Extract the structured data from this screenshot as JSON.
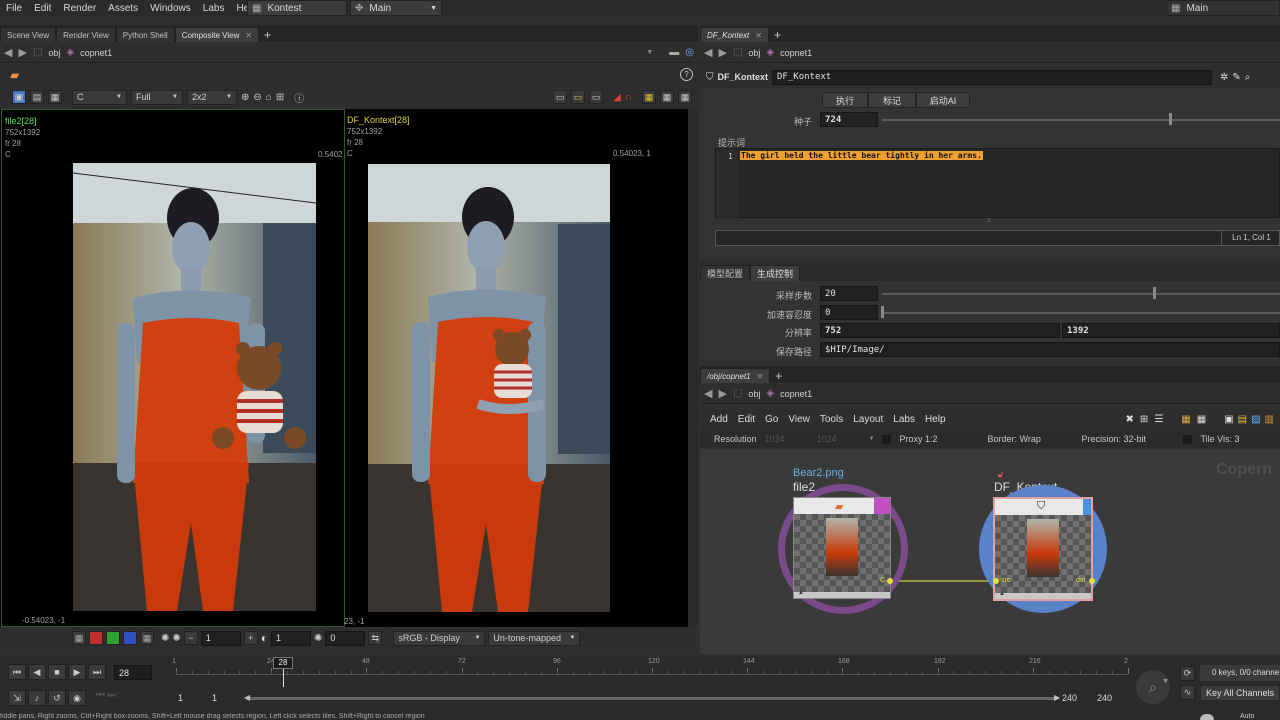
{
  "menubar": {
    "items": [
      "File",
      "Edit",
      "Render",
      "Assets",
      "Windows",
      "Labs",
      "Help"
    ],
    "desktop": "Kontest",
    "network": "Main",
    "right_desktop": "Main"
  },
  "left_tabs": [
    {
      "label": "Scene View",
      "active": false
    },
    {
      "label": "Render View",
      "active": false
    },
    {
      "label": "Python Shell",
      "active": false
    },
    {
      "label": "Composite View",
      "active": true
    }
  ],
  "left_path": {
    "seg1": "obj",
    "seg2": "copnet1"
  },
  "viewer_toolbar": {
    "plane": "C",
    "res": "Full",
    "layout": "2x2"
  },
  "viewport_left": {
    "title": "file2[28]",
    "size": "752x1392",
    "frame": "fr 28",
    "plane": "C",
    "coord_tr": "0.5402",
    "coord_bl": "-0.54023, -1"
  },
  "viewport_right": {
    "title": "DF_Kontext[28]",
    "size": "752x1392",
    "frame": "fr 28",
    "plane": "C",
    "coord_tr": "0.54023, 1",
    "coord_bl": "23, -1"
  },
  "viewer_bottom": {
    "val1": "1",
    "val2": "1",
    "val3": "0",
    "display": "sRGB - Display",
    "tonemap": "Un-tone-mapped"
  },
  "right_tab": {
    "label": "DF_Kontext"
  },
  "right_path": {
    "seg1": "obj",
    "seg2": "copnet1"
  },
  "params": {
    "node_type": "DF_Kontext",
    "node_name": "DF_Kontext",
    "btn_execute": "执行",
    "btn_mark": "标记",
    "btn_start": "启动AI",
    "seed_label": "种子",
    "seed_value": "724",
    "seed_fraction": 0.72,
    "prompt_label": "提示词",
    "prompt_line_no": "1",
    "prompt_text": "The girl held the little bear tightly in her arms.",
    "status": "Ln 1, Col 1",
    "tab1": "模型配置",
    "tab2": "生成控制",
    "steps_label": "采样步数",
    "steps_value": "20",
    "steps_fraction": 0.68,
    "accel_label": "加速容忍度",
    "accel_value": "0",
    "res_label": "分辨率",
    "res_w": "752",
    "res_h": "1392",
    "path_label": "保存路径",
    "path_value": "$HIP/Image/"
  },
  "network": {
    "tab": "/obj/copnet1",
    "path_seg1": "obj",
    "path_seg2": "copnet1",
    "menu": [
      "Add",
      "Edit",
      "Go",
      "View",
      "Tools",
      "Layout",
      "Labs",
      "Help"
    ],
    "resolution_label": "Resolution",
    "res_w": "1024",
    "res_h": "1024",
    "proxy": "Proxy 1:2",
    "border": "Border: Wrap",
    "precision": "Precision: 32-bit",
    "tilevis": "Tile Vis: 3",
    "watermark": "Copern",
    "node1": {
      "label_top": "Bear2.png",
      "name": "file2",
      "out": "C"
    },
    "node2": {
      "name": "DF_Kontext",
      "in": "src",
      "out": "dst"
    }
  },
  "timeline": {
    "frame": "28",
    "ticks": [
      "1",
      "24",
      "48",
      "72",
      "96",
      "120",
      "144",
      "168",
      "192",
      "216",
      "2"
    ],
    "current_marker": "28",
    "start1": "1",
    "start2": "1",
    "end1": "240",
    "end2": "240",
    "keys": "0 keys, 0/0 channe",
    "key_all": "Key All Channels"
  },
  "statusbar": {
    "text": "fiddle pans, Right zooms, Ctrl+Right box-zooms, Shift+Left mouse drag selects region, Left click selects tiles, Shift+Right to cancel region",
    "auto": "Auto"
  },
  "colors": {
    "accent": "#f0a030",
    "wire": "#b8b84a",
    "node_ring1": "#7a4a8a",
    "node_ring2": "#5a82c8"
  }
}
